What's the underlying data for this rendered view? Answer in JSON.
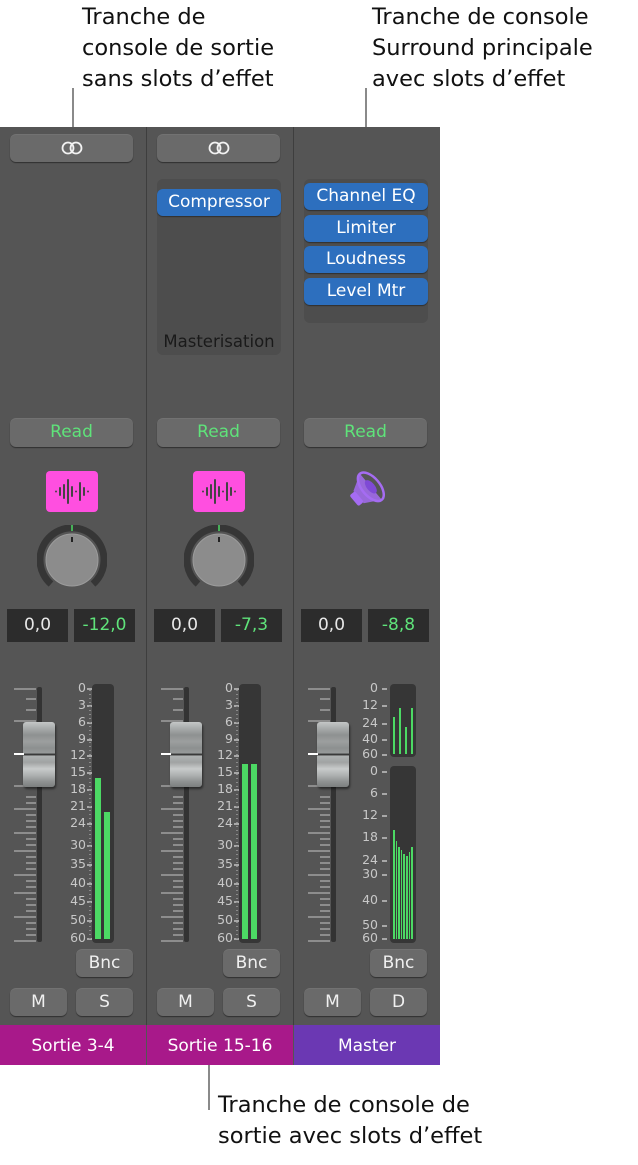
{
  "callouts": {
    "top_left": [
      "Tranche de",
      "console de sortie",
      "sans slots d’effet"
    ],
    "top_right": [
      "Tranche de console",
      "Surround principale",
      "avec slots d’effet"
    ],
    "bottom": [
      "Tranche de console de",
      "sortie avec slots d’effet"
    ]
  },
  "colors": {
    "mixer_bg": "#555555",
    "plugin_blue": "#2d6fbe",
    "read_green": "#5fe37a",
    "meter_green": "#4cd964",
    "output_name_bg": "#a8198a",
    "master_name_bg": "#6b38b3",
    "track_icon_pink": "#ff4fe0",
    "speaker_purple": "#a56cf2"
  },
  "strips": [
    {
      "name": "Sortie 3-4",
      "link_icon": "stereo-link-icon",
      "inserts": [],
      "insert_label": "",
      "automation": "Read",
      "icon": "waveform-icon",
      "pan_knob": true,
      "volume": "0,0",
      "peak": "-12,0",
      "bnc": "Bnc",
      "mute": "M",
      "solo": "S",
      "meter_scale": [
        "0",
        "3",
        "6",
        "9",
        "12",
        "15",
        "18",
        "21",
        "24",
        "30",
        "35",
        "40",
        "45",
        "50",
        "60"
      ],
      "meter_levels_db": [
        -16,
        -22
      ]
    },
    {
      "name": "Sortie 15-16",
      "link_icon": "stereo-link-icon",
      "inserts": [
        "Compressor"
      ],
      "insert_label": "Masterisation",
      "automation": "Read",
      "icon": "waveform-icon",
      "pan_knob": true,
      "volume": "0,0",
      "peak": "-7,3",
      "bnc": "Bnc",
      "mute": "M",
      "solo": "S",
      "meter_scale": [
        "0",
        "3",
        "6",
        "9",
        "12",
        "15",
        "18",
        "21",
        "24",
        "30",
        "35",
        "40",
        "45",
        "50",
        "60"
      ],
      "meter_levels_db": [
        -13.5,
        -13.5
      ]
    },
    {
      "name": "Master",
      "inserts": [
        "Channel EQ",
        "Limiter",
        "Loudness",
        "Level Mtr"
      ],
      "automation": "Read",
      "icon": "speaker-icon",
      "pan_knob": false,
      "volume": "0,0",
      "peak": "-8,8",
      "bnc": "Bnc",
      "mute": "M",
      "solo": "D",
      "surround_meter_scale": [
        "0",
        "12",
        "24",
        "40",
        "60"
      ],
      "surround_levels_db": [
        -20,
        -14,
        -28,
        -14
      ],
      "main_meter_scale": [
        "0",
        "6",
        "12",
        "18",
        "24",
        "30",
        "40",
        "50",
        "60"
      ],
      "main_levels_db": [
        -16,
        -19,
        -20.5,
        -21.5,
        -22.5,
        -23,
        -22,
        -20.5
      ]
    }
  ]
}
